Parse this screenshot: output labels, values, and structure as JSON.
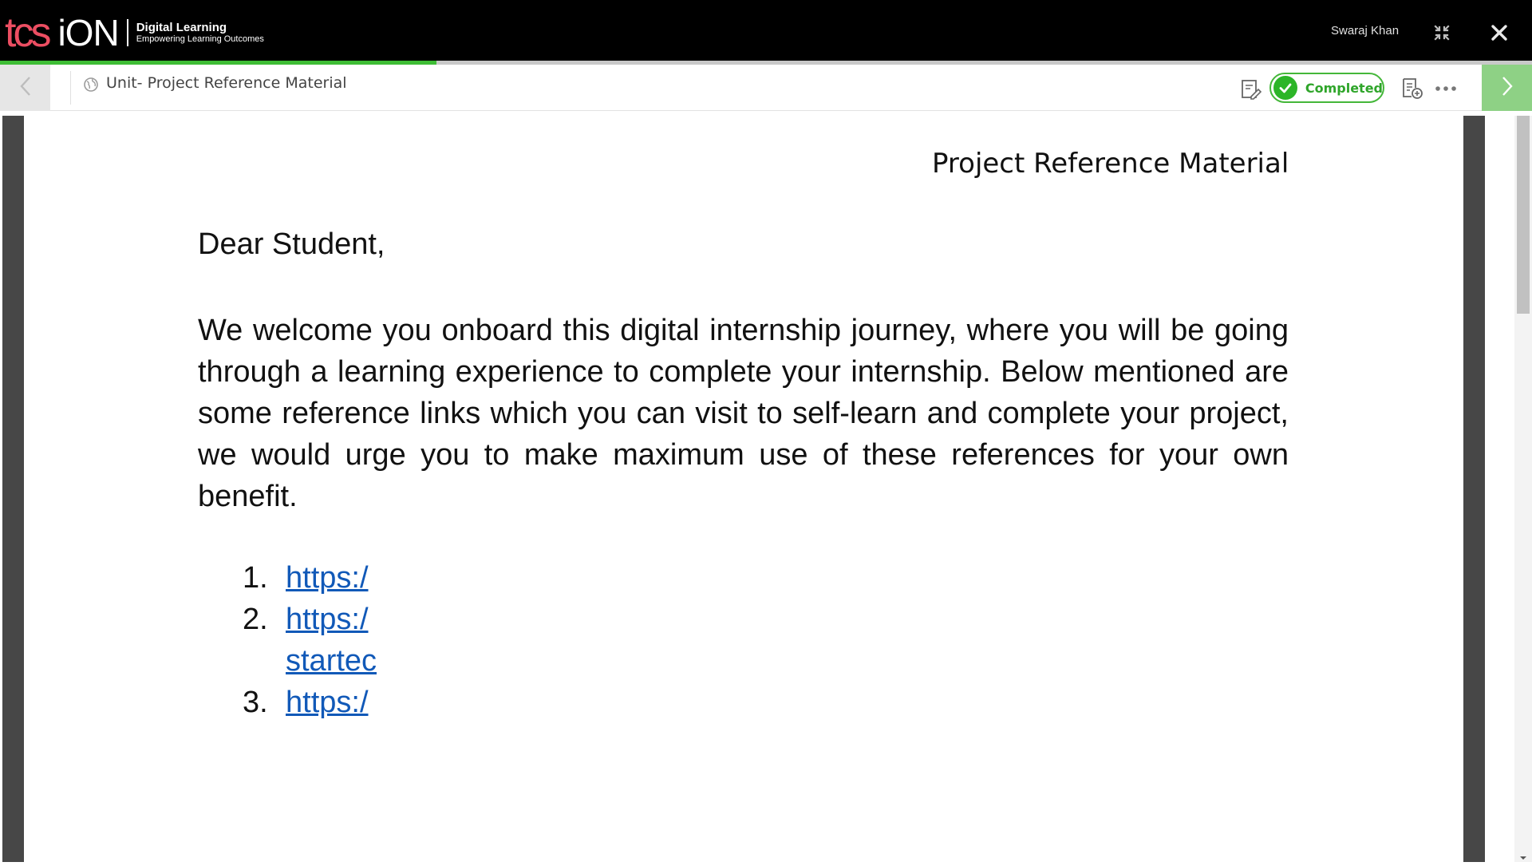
{
  "header": {
    "logo_tcs": "tcs",
    "logo_ion": "iON",
    "brand_title": "Digital Learning",
    "brand_subtitle": "Empowering Learning Outcomes",
    "user_name": "Swaraj Khan",
    "icons": [
      "collapse-icon",
      "close-icon"
    ]
  },
  "progress": {
    "fraction": 0.285,
    "color": "#3ebd35"
  },
  "toolbar": {
    "unit_title": "Unit- Project Reference Material",
    "status_label": "Completed",
    "icons": [
      "chevron-left-icon",
      "globe-icon",
      "edit-document-icon",
      "check-icon",
      "note-add-icon",
      "more-icon",
      "chevron-right-icon"
    ]
  },
  "document": {
    "header_title": "Project Reference Material",
    "greeting": "Dear Student,",
    "paragraph": "We welcome you onboard this digital internship journey, where you will be going through a learning experience to complete your internship. Below mentioned are some reference links which you can visit to self-learn and complete your project, we would urge you to make maximum use of these references for your own benefit.",
    "links": [
      {
        "number": "1.",
        "text": "https:/"
      },
      {
        "number": "2.",
        "text": "https:/",
        "continuation": "startec"
      },
      {
        "number": "3.",
        "text": "https:/"
      }
    ]
  },
  "colors": {
    "brand_red": "#ec4e62",
    "completed_green": "#2cb528",
    "link_blue": "#1159b8",
    "next_button_green": "#8ed185"
  }
}
